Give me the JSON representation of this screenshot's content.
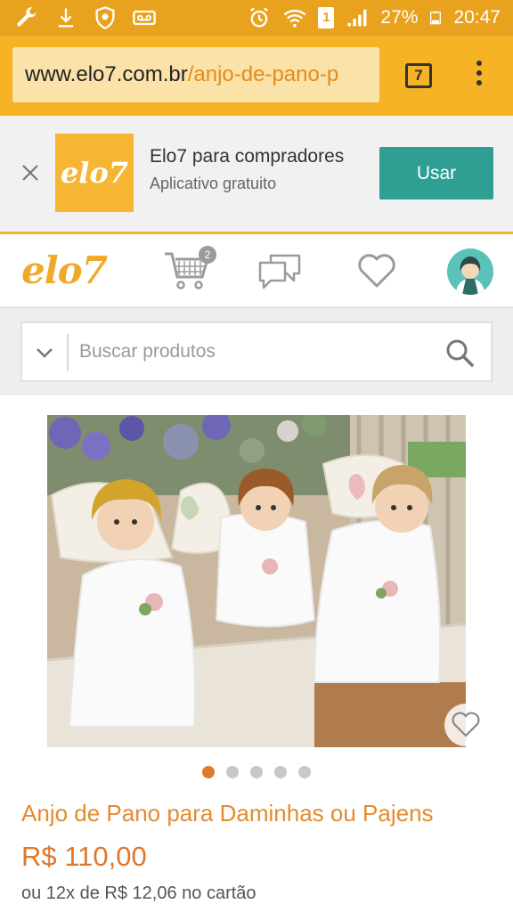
{
  "status_bar": {
    "battery": "27%",
    "time": "20:47",
    "sim_badge": "1"
  },
  "browser": {
    "url_host": "www.elo7.com.br",
    "url_path": "/anjo-de-pano-p",
    "tab_count": "7"
  },
  "app_banner": {
    "logo_text": "elo7",
    "title": "Elo7 para compradores",
    "subtitle": "Aplicativo gratuito",
    "button_label": "Usar"
  },
  "header": {
    "logo_text": "elo7",
    "cart_count": "2"
  },
  "search": {
    "placeholder": "Buscar produtos"
  },
  "product": {
    "title": "Anjo de Pano para Daminhas ou Pajens",
    "price": "R$ 110,00",
    "installments": "ou 12x de R$ 12,06 no cartão",
    "image_count": 5,
    "active_image": 1
  },
  "colors": {
    "accent": "#f5b325",
    "price": "#e0772a",
    "teal": "#2f9e93"
  }
}
